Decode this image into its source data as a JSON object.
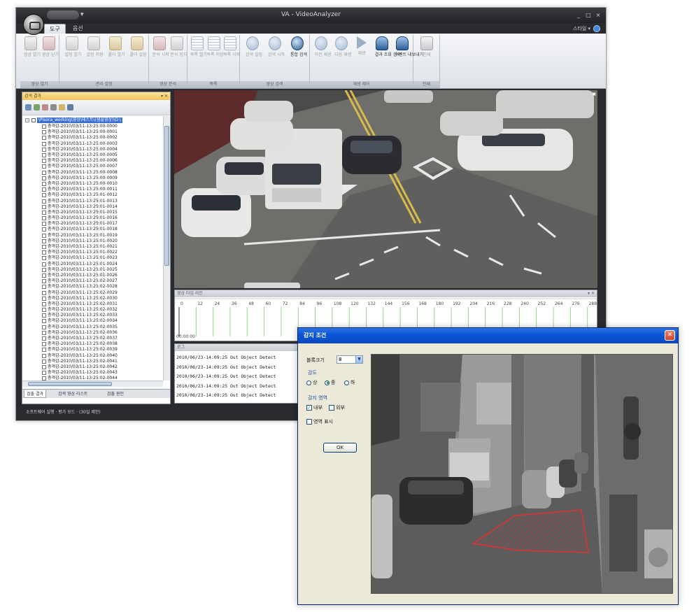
{
  "main_window": {
    "title": "VA - VideoAnalyzer",
    "tabs": [
      "도구",
      "옵션"
    ],
    "style_menu": "스타일 ▾",
    "ribbon_groups": [
      {
        "label": "영상 열기",
        "buttons": [
          {
            "label": "영상 열기",
            "icon": "camera-icon"
          },
          {
            "label": "영상 닫기",
            "icon": "camera-red-icon"
          }
        ]
      },
      {
        "label": "관리 설정",
        "buttons": [
          {
            "label": "설정 열기",
            "icon": "camera-icon"
          },
          {
            "label": "설정 저장",
            "icon": "camera-icon"
          },
          {
            "label": "폴더 열기",
            "icon": "folder-icon"
          },
          {
            "label": "폴더 설정",
            "icon": "folder-icon"
          }
        ]
      },
      {
        "label": "영상 분석",
        "buttons": [
          {
            "label": "분석 시작",
            "icon": "camera-red-icon"
          },
          {
            "label": "분석 정지",
            "icon": "camera-icon"
          }
        ]
      },
      {
        "label": "목록",
        "buttons": [
          {
            "label": "목록 열기",
            "icon": "list-icon"
          },
          {
            "label": "목록 저장",
            "icon": "list-icon"
          },
          {
            "label": "목록 삭제",
            "icon": "list-icon"
          }
        ]
      },
      {
        "label": "영상 검색",
        "buttons": [
          {
            "label": "검색 설정",
            "icon": "search-icon"
          },
          {
            "label": "검색 시작",
            "icon": "search-icon"
          },
          {
            "label": "통합 검색",
            "icon": "search-strong-icon"
          }
        ]
      },
      {
        "label": "재생 제어",
        "buttons": [
          {
            "label": "이전 재생",
            "icon": "rewind-icon"
          },
          {
            "label": "다음 재생",
            "icon": "forward-icon"
          },
          {
            "label": "재생",
            "icon": "play-icon"
          },
          {
            "label": "결과 조회 검색",
            "icon": "person-icon"
          },
          {
            "label": "이벤트 내보내기",
            "icon": "person-icon"
          }
        ]
      },
      {
        "label": "인쇄",
        "buttons": [
          {
            "label": "인쇄",
            "icon": "printer-icon"
          }
        ]
      }
    ],
    "left_panel": {
      "title": "검색 결과",
      "root_label": "\\Pisora_working\\영상\\테스트\\(샘플영상)\\D:\\",
      "items": [
        "충격감-2010/03/11-13:25:00-0000",
        "충격감-2010/03/11-13:25:00-0001",
        "충격감-2010/03/11-13:25:00-0002",
        "충격감-2010/03/11-13:25:00-0003",
        "충격감-2010/03/11-13:25:00-0004",
        "충격감-2010/03/11-13:25:00-0005",
        "충격감-2010/03/11-13:25:00-0006",
        "충격감-2010/03/11-13:25:00-0007",
        "충격감-2010/03/11-13:25:00-0008",
        "충격감-2010/03/11-13:25:00-0009",
        "충격감-2010/03/11-13:25:00-0010",
        "충격감-2010/03/11-13:25:00-0011",
        "충격감-2010/03/11-13:25:01-0012",
        "충격감-2010/03/11-13:25:01-0013",
        "충격감-2010/03/11-13:25:01-0014",
        "충격감-2010/03/11-13:25:01-0015",
        "충격감-2010/03/11-13:25:01-0016",
        "충격감-2010/03/11-13:25:01-0017",
        "충격감-2010/03/11-13:25:01-0018",
        "충격감-2010/03/11-13:25:01-0019",
        "충격감-2010/03/11-13:25:01-0020",
        "충격감-2010/03/11-13:25:01-0021",
        "충격감-2010/03/11-13:25:01-0022",
        "충격감-2010/03/11-13:25:01-0023",
        "충격감-2010/03/11-13:25:01-0024",
        "충격감-2010/03/11-13:25:01-0025",
        "충격감-2010/03/11-13:25:01-0026",
        "충격감-2010/03/11-13:25:02-0027",
        "충격감-2010/03/11-13:25:02-0028",
        "충격감-2010/03/11-13:25:02-0029",
        "충격감-2010/03/11-13:25:02-0030",
        "충격감-2010/03/11-13:25:02-0031",
        "충격감-2010/03/11-13:25:02-0032",
        "충격감-2010/03/11-13:25:02-0033",
        "충격감-2010/03/11-13:25:02-0034",
        "충격감-2010/03/11-13:25:02-0035",
        "충격감-2010/03/11-13:25:02-0036",
        "충격감-2010/03/11-13:25:02-0037",
        "충격감-2010/03/11-13:25:02-0038",
        "충격감-2010/03/11-13:25:02-0039",
        "충격감-2010/03/11-13:25:02-0040",
        "충격감-2010/03/11-13:25:02-0041",
        "충격감-2010/03/11-13:25:02-0042",
        "충격감-2010/03/11-13:25:02-0043",
        "충격감-2010/03/11-13:25:02-0044"
      ],
      "tabs": [
        "검출 결과",
        "검색 영상 리스트",
        "검출 원인"
      ]
    },
    "timeline": {
      "title": "영상 타임 라인",
      "ticks": [
        "0",
        "12",
        "24",
        "36",
        "48",
        "60",
        "72",
        "84",
        "96",
        "108",
        "120",
        "132",
        "144",
        "156",
        "168",
        "180",
        "192",
        "204",
        "216",
        "228",
        "240",
        "252",
        "264",
        "276",
        "288"
      ],
      "time_label": "00:00:00"
    },
    "log": {
      "title": "로그",
      "lines": [
        "2010/06/23-14:09:25 Out Object Detect",
        "2010/06/23-14:09:25 Out Object Detect",
        "2010/06/23-14:09:25 Out Object Detect",
        "2010/06/23-14:09:25 Out Object Detect",
        "2010/06/23-14:09:25 Out Object Detect"
      ]
    },
    "status": "소프트웨어 실행 · 평가 모드 · (30일 제한)"
  },
  "dialog": {
    "title": "감지 조건",
    "block_size_label": "블록크기",
    "block_size_value": "8",
    "sensitivity_title": "감도",
    "sensitivity_options": [
      "상",
      "중",
      "하"
    ],
    "sensitivity_selected": 1,
    "area_title": "감지 영역",
    "area_options": [
      {
        "label": "내부",
        "checked": true
      },
      {
        "label": "외부",
        "checked": false
      }
    ],
    "show_area_label": "영역 표시",
    "show_area_checked": false,
    "ok_label": "OK"
  },
  "colors": {
    "accent_blue": "#0c58d6",
    "region_red": "#e03030"
  }
}
